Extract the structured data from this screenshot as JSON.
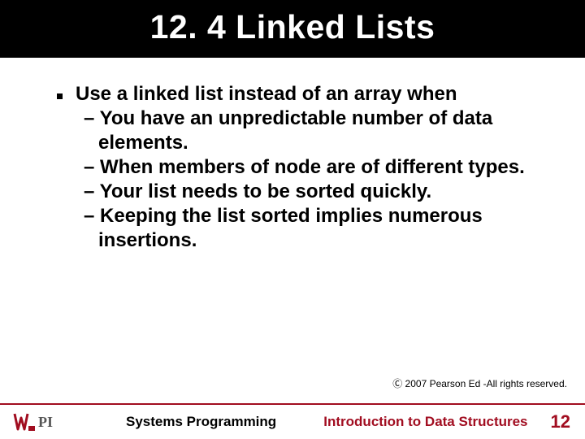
{
  "title": "12. 4 Linked Lists",
  "lead": "Use a linked list instead of an array when",
  "subs": [
    "You have an unpredictable number of data elements.",
    "When members of node are of different types.",
    "Your list needs to be sorted quickly.",
    "Keeping the list sorted implies numerous insertions."
  ],
  "copyright": "Ⓒ 2007 Pearson Ed -All rights reserved.",
  "footer": {
    "left": "Systems Programming",
    "center": "Introduction to Data Structures",
    "page": "12"
  },
  "logo": {
    "text": "WPI"
  }
}
